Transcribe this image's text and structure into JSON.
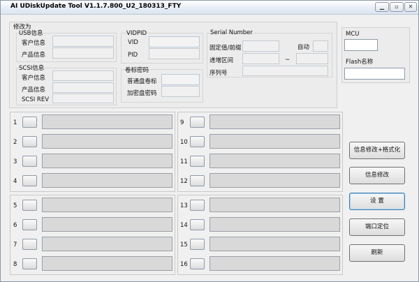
{
  "window": {
    "title": "AI UDiskUpdate Tool V1.1.7.800_U2_180313_FTY",
    "min_icon": "minimize-icon",
    "max_icon": "maximize-icon",
    "close_icon": "close-icon",
    "min_glyph": "▁",
    "max_glyph": "▫",
    "close_glyph": "✕"
  },
  "settings": {
    "title": "修改为",
    "usb": {
      "label": "USB信息",
      "customer": "客户信息",
      "product": "产品信息"
    },
    "scsi": {
      "label": "SCSI信息",
      "customer": "客户信息",
      "product": "产品信息",
      "rev": "SCSI REV"
    },
    "vidpid": {
      "label": "VIDPID",
      "vid": "VID",
      "pid": "PID"
    },
    "volume": {
      "label": "卷标密码",
      "normal": "普通盘卷标",
      "encrypt": "加密盘密码"
    },
    "serial": {
      "label": "Serial Number",
      "prefix": "固定值/前缀",
      "auto": "自动",
      "range": "递增区间",
      "tilde": "~",
      "serial": "序列号"
    }
  },
  "mcu": {
    "label": "MCU",
    "flash": "Flash名称"
  },
  "slots": {
    "left_top": [
      "1",
      "2",
      "3",
      "4"
    ],
    "left_bottom": [
      "5",
      "6",
      "7",
      "8"
    ],
    "right_top": [
      "9",
      "10",
      "11",
      "12"
    ],
    "right_bottom": [
      "13",
      "14",
      "15",
      "16"
    ]
  },
  "actions": {
    "modify_format": "信息修改+格式化",
    "modify": "信息修改",
    "settings": "设 置",
    "port_locate": "端口定位",
    "refresh": "刷新"
  }
}
